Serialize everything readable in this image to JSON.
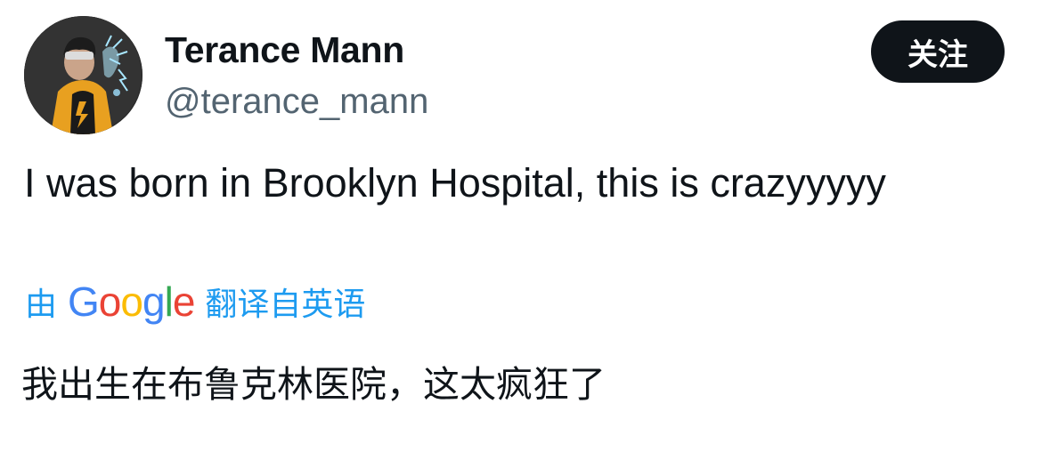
{
  "author": {
    "display_name": "Terance Mann",
    "handle": "@terance_mann",
    "avatar_icon": "avatar-illustration"
  },
  "follow_button": {
    "label": "关注"
  },
  "tweet": {
    "text": "I was born in Brooklyn Hospital, this is crazyyyyy"
  },
  "translation": {
    "by_label": "由",
    "provider": {
      "letters": [
        "G",
        "o",
        "o",
        "g",
        "l",
        "e"
      ],
      "colors": [
        "#4285f4",
        "#ea4335",
        "#fbbc05",
        "#4285f4",
        "#34a853",
        "#ea4335"
      ]
    },
    "from_label": "翻译自英语",
    "translated_text": "我出生在布鲁克林医院，这太疯狂了"
  },
  "colors": {
    "text_primary": "#0f1419",
    "text_secondary": "#536471",
    "link_blue": "#1d9bf0",
    "button_bg": "#0f1419"
  }
}
